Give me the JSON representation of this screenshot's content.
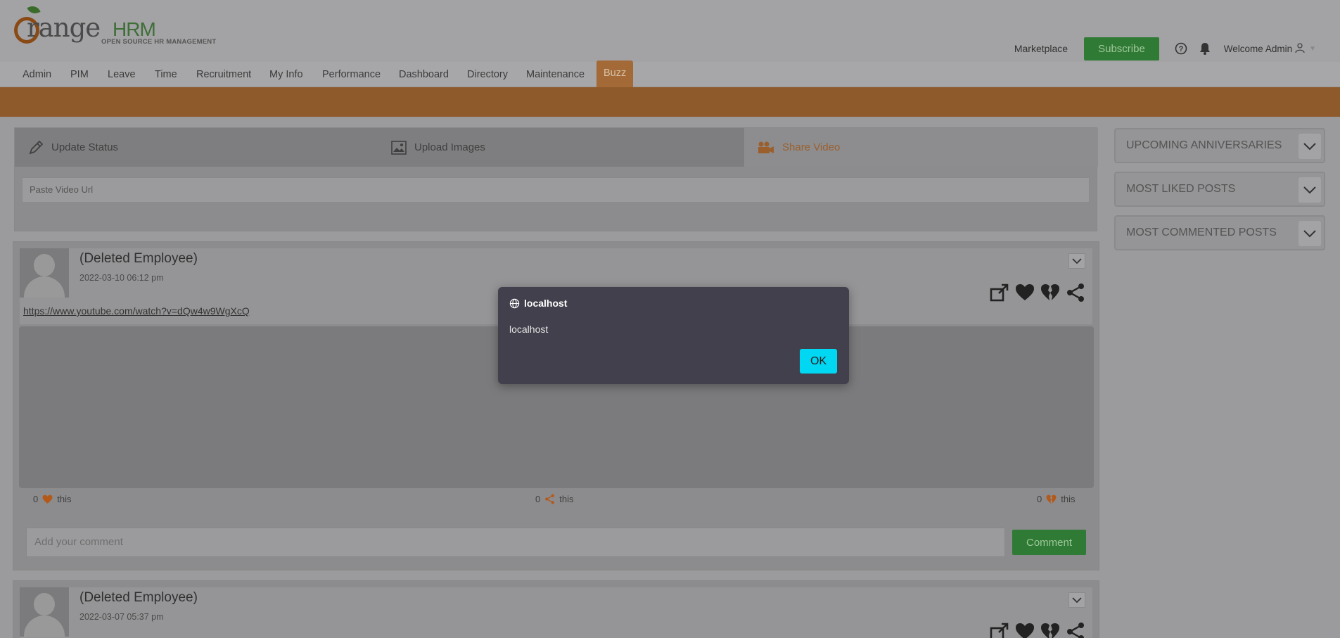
{
  "brand": {
    "name_main": "range",
    "name_accent": "HRM",
    "tagline": "OPEN SOURCE HR MANAGEMENT"
  },
  "header": {
    "marketplace": "Marketplace",
    "subscribe": "Subscribe",
    "welcome": "Welcome Admin"
  },
  "menu": {
    "items": [
      "Admin",
      "PIM",
      "Leave",
      "Time",
      "Recruitment",
      "My Info",
      "Performance",
      "Dashboard",
      "Directory",
      "Maintenance",
      "Buzz"
    ],
    "active": "Buzz"
  },
  "composer": {
    "tabs": [
      "Update Status",
      "Upload Images",
      "Share Video"
    ],
    "active_tab": "Share Video",
    "url_placeholder": "Paste Video Url"
  },
  "posts": [
    {
      "author": "(Deleted Employee)",
      "time": "2022-03-10  06:12 pm",
      "link": "https://www.youtube.com/watch?v=dQw4w9WgXcQ",
      "likes": "0",
      "shares": "0",
      "unlikes": "0",
      "suffix": "this",
      "comment_placeholder": "Add your comment",
      "comment_button": "Comment"
    },
    {
      "author": "(Deleted Employee)",
      "time": "2022-03-07  05:37 pm"
    }
  ],
  "widgets": [
    "UPCOMING ANNIVERSARIES",
    "MOST LIKED POSTS",
    "MOST COMMENTED POSTS"
  ],
  "dialog": {
    "title": "localhost",
    "message": "localhost",
    "ok": "OK"
  },
  "colors": {
    "orange": "#8f5a2b",
    "green": "#2f7a34",
    "dialog_bg": "#42404c",
    "ok_button": "#00d7f2"
  }
}
